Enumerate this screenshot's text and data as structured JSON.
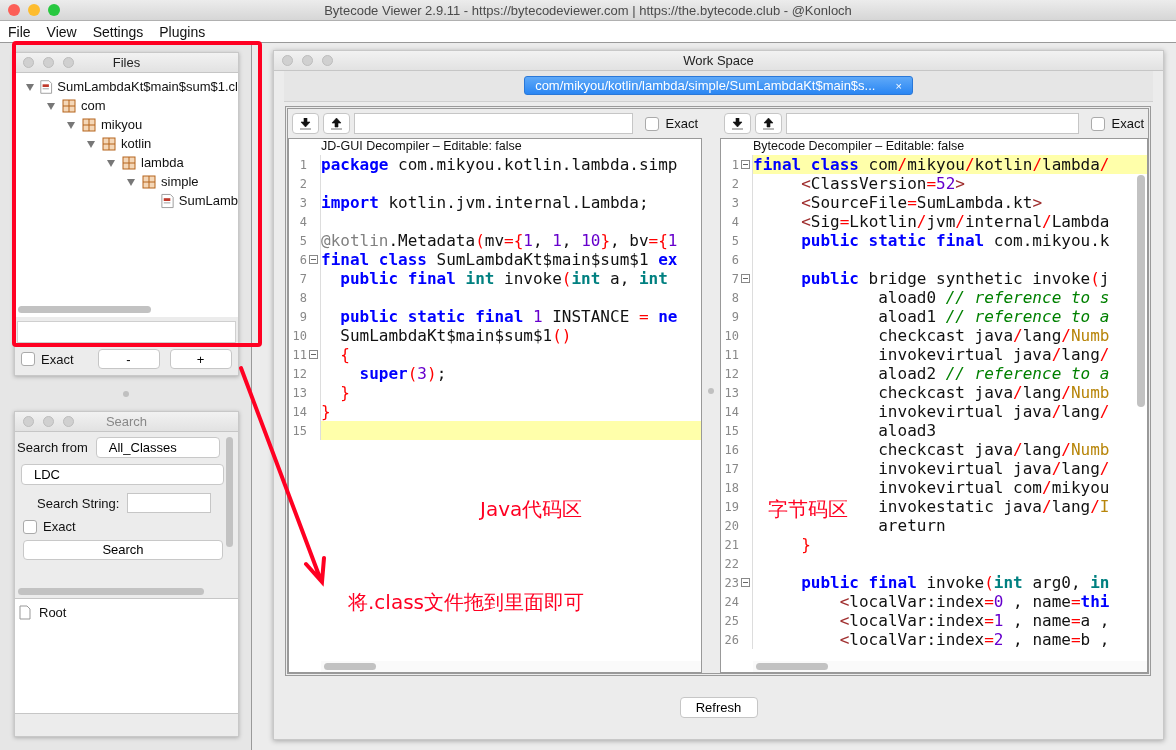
{
  "window": {
    "title": "Bytecode Viewer 2.9.11 - https://bytecodeviewer.com | https://the.bytecode.club - @Konloch"
  },
  "menu": [
    "File",
    "View",
    "Settings",
    "Plugins"
  ],
  "files_panel": {
    "title": "Files",
    "tree": [
      {
        "label": "SumLambdaKt$main$sum$1.cl",
        "kind": "class",
        "expanded": true,
        "children": [
          {
            "label": "com",
            "kind": "package",
            "expanded": true,
            "children": [
              {
                "label": "mikyou",
                "kind": "package",
                "expanded": true,
                "children": [
                  {
                    "label": "kotlin",
                    "kind": "package",
                    "expanded": true,
                    "children": [
                      {
                        "label": "lambda",
                        "kind": "package",
                        "expanded": true,
                        "children": [
                          {
                            "label": "simple",
                            "kind": "package",
                            "expanded": true,
                            "children": [
                              {
                                "label": "SumLamb",
                                "kind": "class"
                              }
                            ]
                          }
                        ]
                      }
                    ]
                  }
                ]
              }
            ]
          }
        ]
      }
    ],
    "exact": {
      "label": "Exact",
      "checked": false
    },
    "buttons": [
      "-",
      "+"
    ]
  },
  "search_panel": {
    "title": "Search",
    "search_from_label": "Search from",
    "search_from": "All_Classes",
    "type": "LDC",
    "search_string_label": "Search String:",
    "exact": {
      "label": "Exact",
      "checked": false
    },
    "search_button": "Search",
    "results": [
      {
        "label": "Root"
      }
    ]
  },
  "workspace": {
    "title": "Work Space",
    "tabs": [
      {
        "label": "com/mikyou/kotlin/lambda/simple/SumLambdaKt$main$s...",
        "close": "×",
        "selected": true
      }
    ],
    "panes": [
      {
        "exact": {
          "label": "Exact",
          "checked": false
        },
        "header": "JD-GUI Decompiler – Editable: false",
        "lines": [
          {
            "n": "1",
            "tokens": [
              {
                "t": "package",
                "kind": "kw"
              },
              {
                "t": " com.mikyou.kotlin.lambda.simp",
                "kind": "plain"
              }
            ]
          },
          {
            "n": "2"
          },
          {
            "n": "3",
            "tokens": [
              {
                "t": "import",
                "kind": "kw"
              },
              {
                "t": " kotlin.jvm.internal.Lambda;",
                "kind": "plain"
              }
            ]
          },
          {
            "n": "4"
          },
          {
            "n": "5",
            "tokens": [
              {
                "t": "@kotlin",
                "kind": "ann"
              },
              {
                "t": ".Metadata",
                "kind": "plain"
              },
              {
                "t": "(",
                "kind": "punc"
              },
              {
                "t": "mv",
                "kind": "plain"
              },
              {
                "t": "={",
                "kind": "punc"
              },
              {
                "t": "1",
                "kind": "num"
              },
              {
                "t": ", ",
                "kind": "plain"
              },
              {
                "t": "1",
                "kind": "num"
              },
              {
                "t": ", ",
                "kind": "plain"
              },
              {
                "t": "10",
                "kind": "num"
              },
              {
                "t": "}",
                "kind": "punc"
              },
              {
                "t": ", bv",
                "kind": "plain"
              },
              {
                "t": "={",
                "kind": "punc"
              },
              {
                "t": "1",
                "kind": "num"
              }
            ]
          },
          {
            "n": "6",
            "fold": true,
            "tokens": [
              {
                "t": "final",
                "kind": "kw"
              },
              {
                "t": " class",
                "kind": "kw"
              },
              {
                "t": " SumLambdaKt$main$sum$1",
                "kind": "plain"
              },
              {
                "t": " ex",
                "kind": "kw"
              }
            ]
          },
          {
            "n": "7",
            "tokens": [
              {
                "t": "  public",
                "kind": "kw"
              },
              {
                "t": " final",
                "kind": "kw"
              },
              {
                "t": " int",
                "kind": "type"
              },
              {
                "t": " invoke",
                "kind": "plain"
              },
              {
                "t": "(",
                "kind": "punc"
              },
              {
                "t": "int",
                "kind": "type"
              },
              {
                "t": " a, ",
                "kind": "plain"
              },
              {
                "t": "int",
                "kind": "type"
              }
            ]
          },
          {
            "n": "8"
          },
          {
            "n": "9",
            "tokens": [
              {
                "t": "  public",
                "kind": "kw"
              },
              {
                "t": " static",
                "kind": "kw"
              },
              {
                "t": " final",
                "kind": "kw"
              },
              {
                "t": " 1",
                "kind": "num"
              },
              {
                "t": " INSTANCE ",
                "kind": "plain"
              },
              {
                "t": "=",
                "kind": "punc"
              },
              {
                "t": " ne",
                "kind": "kw"
              }
            ]
          },
          {
            "n": "10",
            "tokens": [
              {
                "t": "  SumLambdaKt$main$sum$1",
                "kind": "plain"
              },
              {
                "t": "()",
                "kind": "punc"
              }
            ]
          },
          {
            "n": "11",
            "fold": true,
            "tokens": [
              {
                "t": "  {",
                "kind": "punc"
              }
            ]
          },
          {
            "n": "12",
            "tokens": [
              {
                "t": "    super",
                "kind": "kw"
              },
              {
                "t": "(",
                "kind": "punc"
              },
              {
                "t": "3",
                "kind": "num"
              },
              {
                "t": ")",
                "kind": "punc"
              },
              {
                "t": ";",
                "kind": "plain"
              }
            ]
          },
          {
            "n": "13",
            "tokens": [
              {
                "t": "  }",
                "kind": "punc"
              }
            ]
          },
          {
            "n": "14",
            "tokens": [
              {
                "t": "}",
                "kind": "punc"
              }
            ]
          },
          {
            "n": "15",
            "highlight": true
          }
        ]
      },
      {
        "exact": {
          "label": "Exact",
          "checked": false
        },
        "header": "Bytecode Decompiler – Editable: false",
        "lines": [
          {
            "n": "1",
            "fold": true,
            "highlight": true,
            "tokens": [
              {
                "t": "final",
                "kind": "kw"
              },
              {
                "t": " class",
                "kind": "kw"
              },
              {
                "t": " com",
                "kind": "plain"
              },
              {
                "t": "/",
                "kind": "punc"
              },
              {
                "t": "mikyou",
                "kind": "plain"
              },
              {
                "t": "/",
                "kind": "punc"
              },
              {
                "t": "kotlin",
                "kind": "plain"
              },
              {
                "t": "/",
                "kind": "punc"
              },
              {
                "t": "lambda",
                "kind": "plain"
              },
              {
                "t": "/",
                "kind": "punc"
              }
            ]
          },
          {
            "n": "2",
            "tokens": [
              {
                "t": "     <",
                "kind": "tag"
              },
              {
                "t": "ClassVersion",
                "kind": "plain"
              },
              {
                "t": "=",
                "kind": "punc"
              },
              {
                "t": "52",
                "kind": "num"
              },
              {
                "t": ">",
                "kind": "tag"
              }
            ]
          },
          {
            "n": "3",
            "tokens": [
              {
                "t": "     <",
                "kind": "tag"
              },
              {
                "t": "SourceFile",
                "kind": "plain"
              },
              {
                "t": "=",
                "kind": "punc"
              },
              {
                "t": "SumLambda.kt",
                "kind": "plain"
              },
              {
                "t": ">",
                "kind": "tag"
              }
            ]
          },
          {
            "n": "4",
            "tokens": [
              {
                "t": "     <",
                "kind": "tag"
              },
              {
                "t": "Sig",
                "kind": "plain"
              },
              {
                "t": "=",
                "kind": "punc"
              },
              {
                "t": "Lkotlin",
                "kind": "plain"
              },
              {
                "t": "/",
                "kind": "punc"
              },
              {
                "t": "jvm",
                "kind": "plain"
              },
              {
                "t": "/",
                "kind": "punc"
              },
              {
                "t": "internal",
                "kind": "plain"
              },
              {
                "t": "/",
                "kind": "punc"
              },
              {
                "t": "Lambda",
                "kind": "plain"
              }
            ]
          },
          {
            "n": "5",
            "tokens": [
              {
                "t": "     public",
                "kind": "kw"
              },
              {
                "t": " static",
                "kind": "kw"
              },
              {
                "t": " final",
                "kind": "kw"
              },
              {
                "t": " com.mikyou.k",
                "kind": "plain"
              }
            ]
          },
          {
            "n": "6"
          },
          {
            "n": "7",
            "fold": true,
            "tokens": [
              {
                "t": "     public",
                "kind": "kw"
              },
              {
                "t": " bridge synthetic invoke",
                "kind": "plain"
              },
              {
                "t": "(",
                "kind": "punc"
              },
              {
                "t": "j",
                "kind": "plain"
              }
            ]
          },
          {
            "n": "8",
            "tokens": [
              {
                "t": "             aload0 ",
                "kind": "plain"
              },
              {
                "t": "// reference to s",
                "kind": "comment"
              }
            ]
          },
          {
            "n": "9",
            "tokens": [
              {
                "t": "             aload1 ",
                "kind": "plain"
              },
              {
                "t": "// reference to a",
                "kind": "comment"
              }
            ]
          },
          {
            "n": "10",
            "tokens": [
              {
                "t": "             checkcast java",
                "kind": "plain"
              },
              {
                "t": "/",
                "kind": "punc"
              },
              {
                "t": "lang",
                "kind": "plain"
              },
              {
                "t": "/",
                "kind": "punc"
              },
              {
                "t": "Numb",
                "kind": "cls"
              }
            ]
          },
          {
            "n": "11",
            "tokens": [
              {
                "t": "             invokevirtual java",
                "kind": "plain"
              },
              {
                "t": "/",
                "kind": "punc"
              },
              {
                "t": "lang",
                "kind": "plain"
              },
              {
                "t": "/",
                "kind": "punc"
              }
            ]
          },
          {
            "n": "12",
            "tokens": [
              {
                "t": "             aload2 ",
                "kind": "plain"
              },
              {
                "t": "// reference to a",
                "kind": "comment"
              }
            ]
          },
          {
            "n": "13",
            "tokens": [
              {
                "t": "             checkcast java",
                "kind": "plain"
              },
              {
                "t": "/",
                "kind": "punc"
              },
              {
                "t": "lang",
                "kind": "plain"
              },
              {
                "t": "/",
                "kind": "punc"
              },
              {
                "t": "Numb",
                "kind": "cls"
              }
            ]
          },
          {
            "n": "14",
            "tokens": [
              {
                "t": "             invokevirtual java",
                "kind": "plain"
              },
              {
                "t": "/",
                "kind": "punc"
              },
              {
                "t": "lang",
                "kind": "plain"
              },
              {
                "t": "/",
                "kind": "punc"
              }
            ]
          },
          {
            "n": "15",
            "tokens": [
              {
                "t": "             aload3",
                "kind": "plain"
              }
            ]
          },
          {
            "n": "16",
            "tokens": [
              {
                "t": "             checkcast java",
                "kind": "plain"
              },
              {
                "t": "/",
                "kind": "punc"
              },
              {
                "t": "lang",
                "kind": "plain"
              },
              {
                "t": "/",
                "kind": "punc"
              },
              {
                "t": "Numb",
                "kind": "cls"
              }
            ]
          },
          {
            "n": "17",
            "tokens": [
              {
                "t": "             invokevirtual java",
                "kind": "plain"
              },
              {
                "t": "/",
                "kind": "punc"
              },
              {
                "t": "lang",
                "kind": "plain"
              },
              {
                "t": "/",
                "kind": "punc"
              }
            ]
          },
          {
            "n": "18",
            "tokens": [
              {
                "t": "             invokevirtual com",
                "kind": "plain"
              },
              {
                "t": "/",
                "kind": "punc"
              },
              {
                "t": "mikyou",
                "kind": "plain"
              }
            ]
          },
          {
            "n": "19",
            "tokens": [
              {
                "t": "             invokestatic java",
                "kind": "plain"
              },
              {
                "t": "/",
                "kind": "punc"
              },
              {
                "t": "lang",
                "kind": "plain"
              },
              {
                "t": "/",
                "kind": "punc"
              },
              {
                "t": "I",
                "kind": "cls"
              }
            ]
          },
          {
            "n": "20",
            "tokens": [
              {
                "t": "             areturn",
                "kind": "plain"
              }
            ]
          },
          {
            "n": "21",
            "tokens": [
              {
                "t": "     }",
                "kind": "punc"
              }
            ]
          },
          {
            "n": "22"
          },
          {
            "n": "23",
            "fold": true,
            "tokens": [
              {
                "t": "     public",
                "kind": "kw"
              },
              {
                "t": " final",
                "kind": "kw"
              },
              {
                "t": " invoke",
                "kind": "plain"
              },
              {
                "t": "(",
                "kind": "punc"
              },
              {
                "t": "int",
                "kind": "type"
              },
              {
                "t": " arg0, ",
                "kind": "plain"
              },
              {
                "t": "in",
                "kind": "type"
              }
            ]
          },
          {
            "n": "24",
            "tokens": [
              {
                "t": "         <",
                "kind": "tag"
              },
              {
                "t": "localVar:index",
                "kind": "plain"
              },
              {
                "t": "=",
                "kind": "punc"
              },
              {
                "t": "0",
                "kind": "num"
              },
              {
                "t": " , name",
                "kind": "plain"
              },
              {
                "t": "=",
                "kind": "punc"
              },
              {
                "t": "thi",
                "kind": "kw"
              }
            ]
          },
          {
            "n": "25",
            "tokens": [
              {
                "t": "         <",
                "kind": "tag"
              },
              {
                "t": "localVar:index",
                "kind": "plain"
              },
              {
                "t": "=",
                "kind": "punc"
              },
              {
                "t": "1",
                "kind": "num"
              },
              {
                "t": " , name",
                "kind": "plain"
              },
              {
                "t": "=",
                "kind": "punc"
              },
              {
                "t": "a ,",
                "kind": "plain"
              }
            ]
          },
          {
            "n": "26",
            "tokens": [
              {
                "t": "         <",
                "kind": "tag"
              },
              {
                "t": "localVar:index",
                "kind": "plain"
              },
              {
                "t": "=",
                "kind": "punc"
              },
              {
                "t": "2",
                "kind": "num"
              },
              {
                "t": " , name",
                "kind": "plain"
              },
              {
                "t": "=",
                "kind": "punc"
              },
              {
                "t": "b ,",
                "kind": "plain"
              }
            ]
          }
        ]
      }
    ],
    "refresh_button": "Refresh"
  },
  "annotations": [
    {
      "kind": "box"
    },
    {
      "kind": "arrow"
    },
    {
      "kind": "label",
      "text": "Java代码区"
    },
    {
      "kind": "label",
      "text": "字节码区"
    },
    {
      "kind": "label",
      "text": "将.class文件拖到里面即可"
    }
  ]
}
